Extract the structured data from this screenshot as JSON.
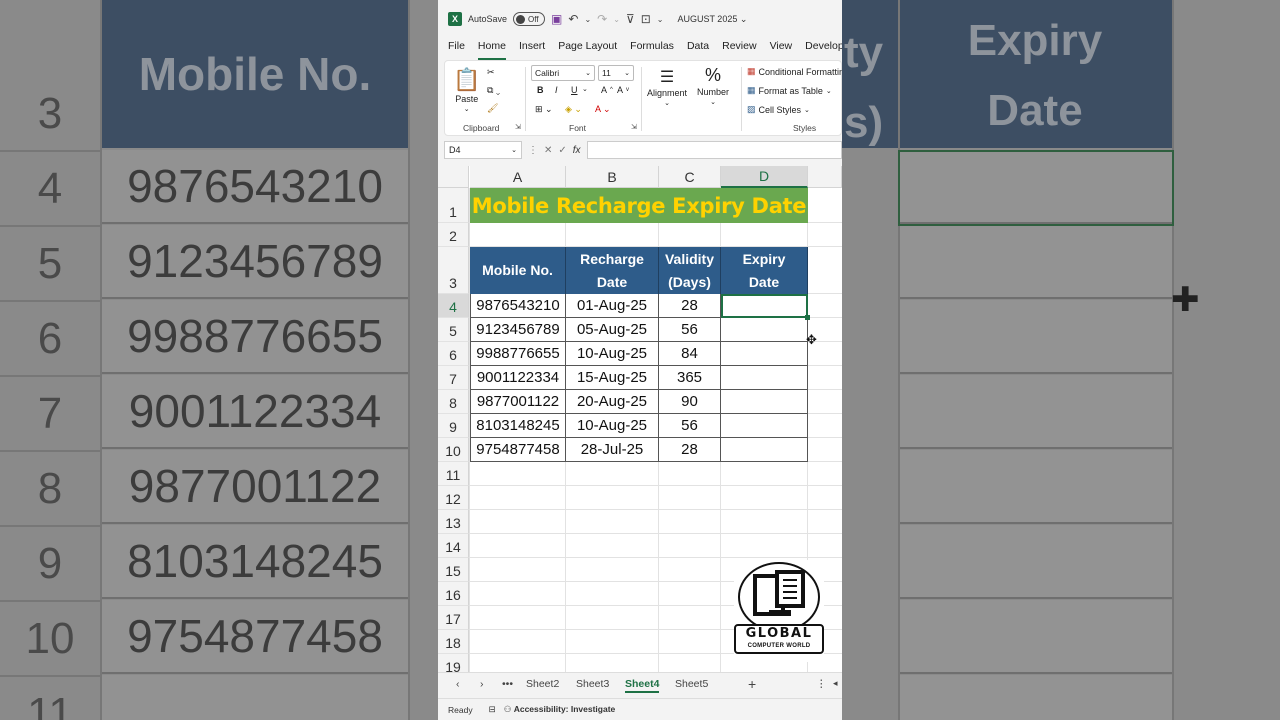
{
  "background": {
    "header_left": "Mobile No.",
    "header_mid_partial": "",
    "header_mid_partial_2": "",
    "header_right_line1": "Expiry",
    "header_right_line2": "Date",
    "header_partial_1": "ty",
    "header_partial_2": "s)",
    "rows": [
      {
        "num": "3",
        "value": ""
      },
      {
        "num": "4",
        "value": "9876543210"
      },
      {
        "num": "5",
        "value": "9123456789"
      },
      {
        "num": "6",
        "value": "9988776655"
      },
      {
        "num": "7",
        "value": "9001122334"
      },
      {
        "num": "8",
        "value": "9877001122"
      },
      {
        "num": "9",
        "value": "8103148245"
      },
      {
        "num": "10",
        "value": "9754877458"
      },
      {
        "num": "11",
        "value": ""
      }
    ]
  },
  "titlebar": {
    "app_icon": "X",
    "autosave_label": "AutoSave",
    "autosave_state": "Off",
    "file_title": "AUGUST 2025"
  },
  "menu": [
    "File",
    "Home",
    "Insert",
    "Page Layout",
    "Formulas",
    "Data",
    "Review",
    "View",
    "Develop"
  ],
  "ribbon": {
    "paste": "Paste",
    "clipboard": "Clipboard",
    "font_name": "Calibri",
    "font_size": "11",
    "bold": "B",
    "italic": "I",
    "underline": "U",
    "font": "Font",
    "alignment": "Alignment",
    "number": "Number",
    "number_glyph": "%",
    "conditional": "Conditional Formattin",
    "format_table": "Format as Table",
    "cell_styles": "Cell Styles",
    "styles": "Styles"
  },
  "formula_bar": {
    "name_box": "D4",
    "fx": "fx",
    "value": ""
  },
  "sheet": {
    "columns": [
      "A",
      "B",
      "C",
      "D"
    ],
    "rows": [
      "1",
      "2",
      "3",
      "4",
      "5",
      "6",
      "7",
      "8",
      "9",
      "10",
      "11",
      "12",
      "13",
      "14",
      "15",
      "16",
      "17",
      "18",
      "19"
    ],
    "title": "Mobile Recharge Expiry Date",
    "headers": {
      "mobile": "Mobile No.",
      "recharge_1": "Recharge",
      "recharge_2": "Date",
      "validity_1": "Validity",
      "validity_2": "(Days)",
      "expiry_1": "Expiry",
      "expiry_2": "Date"
    },
    "data": [
      {
        "mobile": "9876543210",
        "date": "01-Aug-25",
        "days": "28",
        "expiry": ""
      },
      {
        "mobile": "9123456789",
        "date": "05-Aug-25",
        "days": "56",
        "expiry": ""
      },
      {
        "mobile": "9988776655",
        "date": "10-Aug-25",
        "days": "84",
        "expiry": ""
      },
      {
        "mobile": "9001122334",
        "date": "15-Aug-25",
        "days": "365",
        "expiry": ""
      },
      {
        "mobile": "9877001122",
        "date": "20-Aug-25",
        "days": "90",
        "expiry": ""
      },
      {
        "mobile": "8103148245",
        "date": "10-Aug-25",
        "days": "56",
        "expiry": ""
      },
      {
        "mobile": "9754877458",
        "date": "28-Jul-25",
        "days": "28",
        "expiry": ""
      }
    ]
  },
  "logo": {
    "line1": "GLOBAL",
    "line2": "COMPUTER WORLD"
  },
  "tabs": [
    "Sheet2",
    "Sheet3",
    "Sheet4",
    "Sheet5"
  ],
  "active_tab": "Sheet4",
  "add_sheet": "+",
  "status": {
    "ready": "Ready",
    "accessibility": "Accessibility: Investigate"
  },
  "colors": {
    "excel_green": "#1e7145",
    "title_fill": "#6aa84f",
    "title_text": "#ffd200",
    "header_fill": "#2e5c8a"
  }
}
